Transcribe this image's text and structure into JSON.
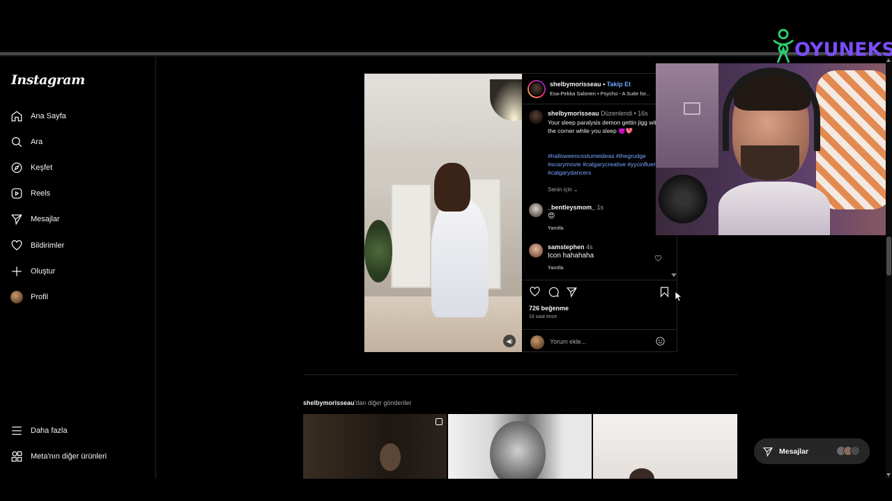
{
  "app": {
    "brand": "Instagram"
  },
  "sidebar": {
    "items": [
      {
        "label": "Ana Sayfa",
        "icon": "home-icon"
      },
      {
        "label": "Ara",
        "icon": "search-icon"
      },
      {
        "label": "Keşfet",
        "icon": "compass-icon"
      },
      {
        "label": "Reels",
        "icon": "reels-icon"
      },
      {
        "label": "Mesajlar",
        "icon": "send-icon"
      },
      {
        "label": "Bildirimler",
        "icon": "heart-icon"
      },
      {
        "label": "Oluştur",
        "icon": "plus-icon"
      },
      {
        "label": "Profil",
        "icon": "avatar"
      }
    ],
    "bottom": [
      {
        "label": "Daha fazla",
        "icon": "menu-icon"
      },
      {
        "label": "Meta'nın diğer ürünleri",
        "icon": "apps-icon"
      }
    ]
  },
  "post": {
    "username": "shelbymorisseau",
    "separator": "•",
    "follow_label": "Takip Et",
    "music": "Esa-Pekka Salonen • Psycho - A Suite for...",
    "caption": {
      "username": "shelbymorisseau",
      "edited": "Düzenlendi •",
      "time": "16s",
      "text": "Your sleep paralysis demon gettin jigg with it in the corner while you sleep 👿💖",
      "hashtags": "#halloweencostumeideas #thegrudge #scarymovie #calgarycreative #yycinfluencer #calgarydancers"
    },
    "for_you": "Senin için",
    "comments": [
      {
        "username": "_bentleysmom_",
        "time": "1s",
        "text": "😍",
        "reply": "Yanıtla"
      },
      {
        "username": "samstephen",
        "time": "4s",
        "text": "Icon hahahaha",
        "reply": "Yanıtla"
      }
    ],
    "likes": "726 beğenme",
    "ago": "16 saat önce",
    "add_comment_placeholder": "Yorum ekle..."
  },
  "more": {
    "username": "shelbymorisseau",
    "suffix": "'dan diğer gönderiler"
  },
  "overlay": {
    "logo_text": "OYUNEKS"
  },
  "messages_button": {
    "label": "Mesajlar"
  },
  "colors": {
    "link": "#70a8ff",
    "hashtag": "#7aa6ff",
    "logo": "#7b4dff",
    "logo_mark": "#2ecc71"
  }
}
